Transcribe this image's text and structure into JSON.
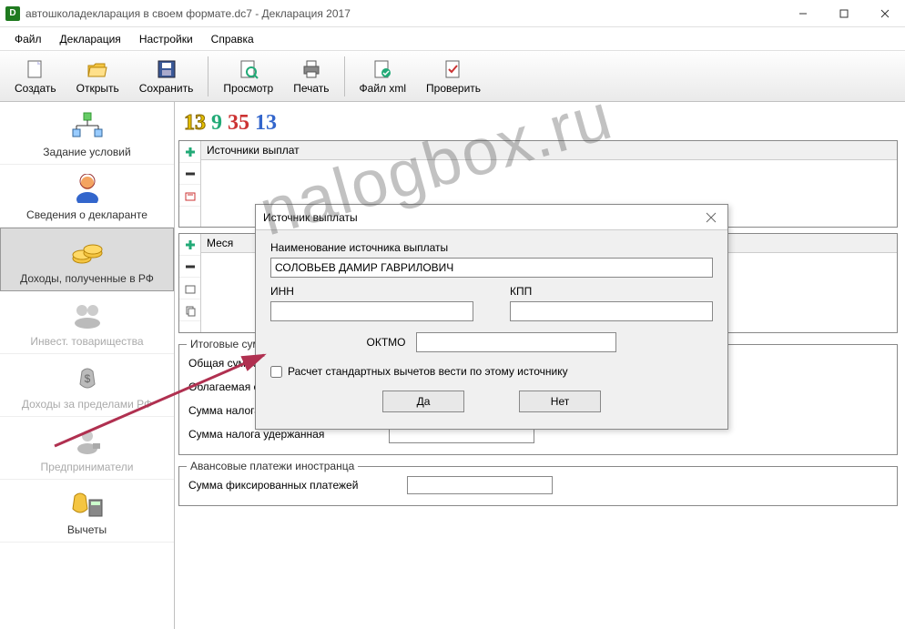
{
  "window": {
    "title": "автошколадекларация в своем формате.dc7 - Декларация 2017",
    "app_icon": "D"
  },
  "menu": {
    "file": "Файл",
    "decl": "Декларация",
    "settings": "Настройки",
    "help": "Справка"
  },
  "toolbar": {
    "create": "Создать",
    "open": "Открыть",
    "save": "Сохранить",
    "preview": "Просмотр",
    "print": "Печать",
    "xml": "Файл xml",
    "check": "Проверить"
  },
  "sidebar": {
    "items": [
      {
        "label": "Задание условий"
      },
      {
        "label": "Сведения о декларанте"
      },
      {
        "label": "Доходы, полученные в РФ"
      },
      {
        "label": "Инвест. товарищества"
      },
      {
        "label": "Доходы за пределами РФ"
      },
      {
        "label": "Предприниматели"
      },
      {
        "label": "Вычеты"
      }
    ]
  },
  "rates": {
    "r1": "13",
    "r2": "9",
    "r3": "35",
    "r4": "13"
  },
  "panel1": {
    "title": "Источники выплат"
  },
  "panel2": {
    "title": "Меся"
  },
  "totals": {
    "legend": "Итоговые суммы по источнику выплат",
    "row1": "Общая сумма дохода",
    "row2": "Облагаемая сумма дохода",
    "row3": "Сумма налога исчисленная",
    "row4": "Сумма налога удержанная"
  },
  "advance": {
    "legend": "Авансовые платежи иностранца",
    "label": "Сумма фиксированных платежей"
  },
  "dialog": {
    "title": "Источник выплаты",
    "name_label": "Наименование источника выплаты",
    "name_value": "СОЛОВЬЕВ ДАМИР ГАВРИЛОВИЧ",
    "inn_label": "ИНН",
    "kpp_label": "КПП",
    "oktmo_label": "ОКТМО",
    "checkbox_label": "Расчет стандартных вычетов вести по этому источнику",
    "yes": "Да",
    "no": "Нет"
  },
  "watermark": "nalogbox.ru"
}
